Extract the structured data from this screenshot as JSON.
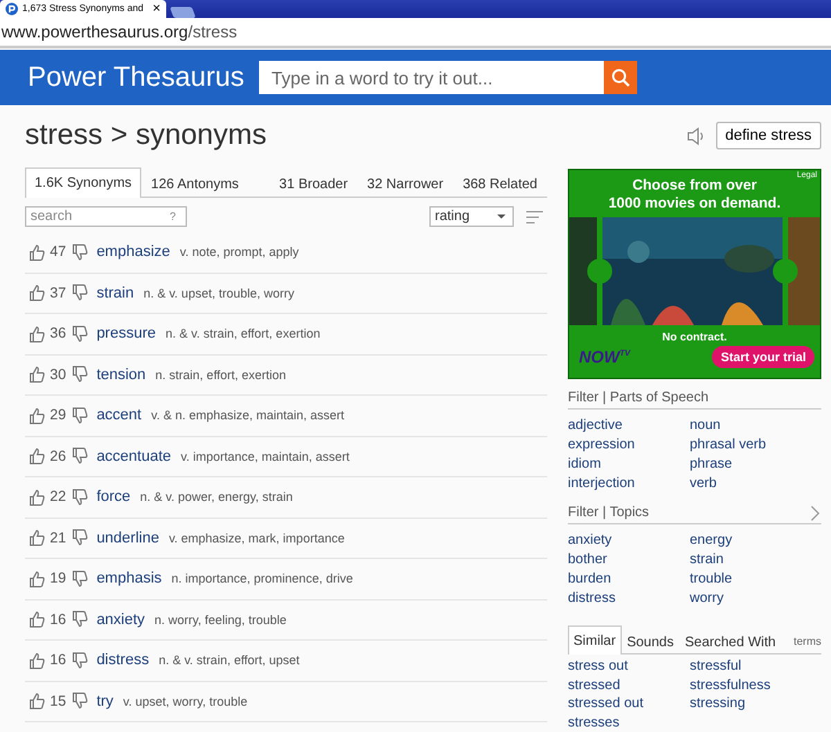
{
  "browser": {
    "tab_title": "1,673 Stress Synonyms and",
    "close": "×",
    "address_host": "www.powerthesaurus.org",
    "address_path": "/stress"
  },
  "header": {
    "logo": "Power Thesaurus",
    "search": {
      "placeholder": "Type in a word to try it out..."
    }
  },
  "page": {
    "title": "stress > synonyms",
    "define_button": "define stress"
  },
  "tabs": [
    {
      "label": "1.6K Synonyms",
      "selected": true
    },
    {
      "label": "126 Antonyms",
      "selected": false
    },
    {
      "label": "31 Broader",
      "selected": false
    },
    {
      "label": "32 Narrower",
      "selected": false
    },
    {
      "label": "368 Related",
      "selected": false
    }
  ],
  "filter": {
    "search": {
      "placeholder": "search"
    },
    "help": "?",
    "sort": {
      "value": "rating"
    }
  },
  "synonyms": [
    {
      "votes": "47",
      "word": "emphasize",
      "details": "v. note, prompt, apply"
    },
    {
      "votes": "37",
      "word": "strain",
      "details": "n. & v. upset, trouble, worry"
    },
    {
      "votes": "36",
      "word": "pressure",
      "details": "n. & v. strain, effort, exertion"
    },
    {
      "votes": "30",
      "word": "tension",
      "details": "n. strain, effort, exertion"
    },
    {
      "votes": "29",
      "word": "accent",
      "details": "v. & n. emphasize, maintain, assert"
    },
    {
      "votes": "26",
      "word": "accentuate",
      "details": "v. importance, maintain, assert"
    },
    {
      "votes": "22",
      "word": "force",
      "details": "n. & v. power, energy, strain"
    },
    {
      "votes": "21",
      "word": "underline",
      "details": "v. emphasize, mark, importance"
    },
    {
      "votes": "19",
      "word": "emphasis",
      "details": "n. importance, prominence, drive"
    },
    {
      "votes": "16",
      "word": "anxiety",
      "details": "n. worry, feeling, trouble"
    },
    {
      "votes": "16",
      "word": "distress",
      "details": "n. & v. strain, effort, upset"
    },
    {
      "votes": "15",
      "word": "try",
      "details": "v. upset, worry, trouble"
    }
  ],
  "ad": {
    "legal": "Legal",
    "headline": [
      "Choose from over",
      "1000 movies on demand."
    ],
    "note": "No contract.",
    "logo": "NOW",
    "logo_sup": "TV",
    "cta": "Start your trial"
  },
  "parts_of_speech": {
    "heading": "Filter | Parts of Speech",
    "items": [
      "adjective",
      "noun",
      "expression",
      "phrasal verb",
      "idiom",
      "phrase",
      "interjection",
      "verb"
    ]
  },
  "topics": {
    "heading": "Filter | Topics",
    "items": [
      "anxiety",
      "energy",
      "bother",
      "strain",
      "burden",
      "trouble",
      "distress",
      "worry"
    ]
  },
  "related_tabs": [
    {
      "label": "Similar",
      "selected": true
    },
    {
      "label": "Sounds",
      "selected": false
    },
    {
      "label": "Searched With",
      "selected": false
    }
  ],
  "related_terms_label": "terms",
  "similar": [
    "stress out",
    "stressful",
    "stressed",
    "stressfulness",
    "stressed out",
    "stressing",
    "stresses"
  ]
}
